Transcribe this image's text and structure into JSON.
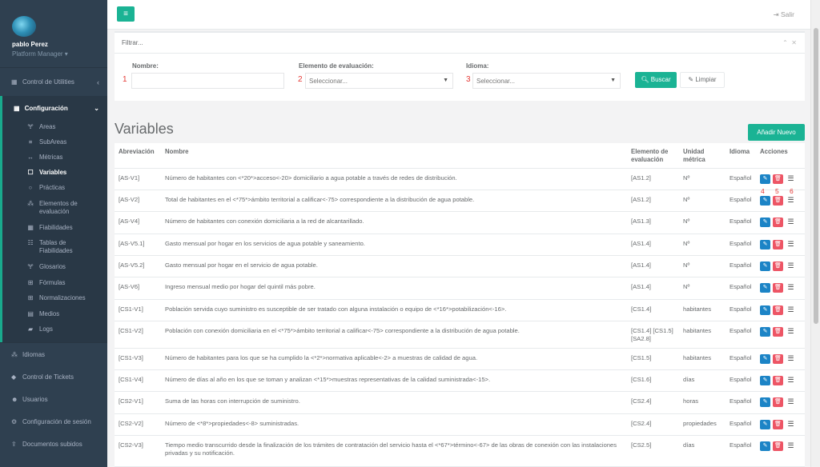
{
  "sidebar": {
    "user_name": "pablo Perez",
    "user_role": "Platform Manager ▾",
    "control_utilities": "Control de Utilities",
    "configuracion": "Configuración",
    "sub_items": [
      {
        "icon": "🝖",
        "label": "Areas"
      },
      {
        "icon": "≡",
        "label": "SubAreas"
      },
      {
        "icon": "↔",
        "label": "Métricas"
      },
      {
        "icon": "☐",
        "label": "Variables"
      },
      {
        "icon": "○",
        "label": "Prácticas"
      },
      {
        "icon": "⁂",
        "label": "Elementos de evaluación"
      },
      {
        "icon": "▦",
        "label": "Fiabilidades"
      },
      {
        "icon": "☷",
        "label": "Tablas de Fiabilidades"
      },
      {
        "icon": "🝖",
        "label": "Glosarios"
      },
      {
        "icon": "⊞",
        "label": "Fórmulas"
      },
      {
        "icon": "⊞",
        "label": "Normalizaciones"
      },
      {
        "icon": "▤",
        "label": "Medios"
      },
      {
        "icon": "▰",
        "label": "Logs"
      }
    ],
    "after_items": [
      {
        "icon": "⁂",
        "label": "Idiomas"
      },
      {
        "icon": "◆",
        "label": "Control de Tickets"
      },
      {
        "icon": "☻",
        "label": "Usuarios"
      },
      {
        "icon": "⚙",
        "label": "Configuración de sesión"
      },
      {
        "icon": "⇪",
        "label": "Documentos subidos"
      }
    ]
  },
  "topbar": {
    "menu": "≡",
    "logout": "Salir"
  },
  "filter": {
    "title": "Filtrar...",
    "nombre_label": "Nombre:",
    "elemento_label": "Elemento de evaluación:",
    "idioma_label": "Idioma:",
    "elemento_placeholder": "Seleccionar...",
    "idioma_placeholder": "Seleccionar...",
    "buscar": "Buscar",
    "limpiar": "Limpiar",
    "num1": "1",
    "num2": "2",
    "num3": "3"
  },
  "page": {
    "title": "Variables",
    "add_button": "Añadir Nuevo"
  },
  "table": {
    "headers": {
      "abrev": "Abreviación",
      "nombre": "Nombre",
      "elemento": "Elemento de evaluación",
      "unidad": "Unidad métrica",
      "idioma": "Idioma",
      "acciones": "Acciones"
    },
    "rows": [
      {
        "abrev": "[AS-V1]",
        "nombre": "Número de habitantes con <*20*>acceso<-20> domiciliario a agua potable a través de redes de distribución.",
        "elemento": "[AS1.2]",
        "unidad": "Nº",
        "idioma": "Español"
      },
      {
        "abrev": "[AS-V2]",
        "nombre": "Total de habitantes en el <*75*>ámbito territorial a calificar<-75> correspondiente a la distribución de agua potable.",
        "elemento": "[AS1.2]",
        "unidad": "Nº",
        "idioma": "Español"
      },
      {
        "abrev": "[AS-V4]",
        "nombre": "Número de habitantes con conexión domiciliaria a la red de alcantarillado.",
        "elemento": "[AS1.3]",
        "unidad": "Nº",
        "idioma": "Español"
      },
      {
        "abrev": "[AS-V5.1]",
        "nombre": "Gasto mensual por hogar en los servicios de agua potable y saneamiento.",
        "elemento": "[AS1.4]",
        "unidad": "Nº",
        "idioma": "Español"
      },
      {
        "abrev": "[AS-V5.2]",
        "nombre": "Gasto mensual por hogar en el servicio de agua potable.",
        "elemento": "[AS1.4]",
        "unidad": "Nº",
        "idioma": "Español"
      },
      {
        "abrev": "[AS-V6]",
        "nombre": "Ingreso mensual medio por hogar del quintil más pobre.",
        "elemento": "[AS1.4]",
        "unidad": "Nº",
        "idioma": "Español"
      },
      {
        "abrev": "[CS1-V1]",
        "nombre": "Población servida cuyo suministro es susceptible de ser tratado con alguna instalación o equipo de <*16*>potabilización<-16>.",
        "elemento": "[CS1.4]",
        "unidad": "habitantes",
        "idioma": "Español"
      },
      {
        "abrev": "[CS1-V2]",
        "nombre": "Población con conexión domiciliaria en el <*75*>ámbito territorial a calificar<-75> correspondiente a la distribución de agua potable.",
        "elemento": "[CS1.4] [CS1.5] [SA2.8]",
        "unidad": "habitantes",
        "idioma": "Español"
      },
      {
        "abrev": "[CS1-V3]",
        "nombre": "Número de habitantes para los que se ha cumplido la <*2*>normativa aplicable<-2> a muestras de calidad de agua.",
        "elemento": "[CS1.5]",
        "unidad": "habitantes",
        "idioma": "Español"
      },
      {
        "abrev": "[CS1-V4]",
        "nombre": "Número de días al año en los que se toman y analizan <*15*>muestras representativas de la calidad suministrada<-15>.",
        "elemento": "[CS1.6]",
        "unidad": "días",
        "idioma": "Español"
      },
      {
        "abrev": "[CS2-V1]",
        "nombre": "Suma de las horas con interrupción de suministro.",
        "elemento": "[CS2.4]",
        "unidad": "horas",
        "idioma": "Español"
      },
      {
        "abrev": "[CS2-V2]",
        "nombre": "Número de <*8*>propiedades<-8> suministradas.",
        "elemento": "[CS2.4]",
        "unidad": "propiedades",
        "idioma": "Español"
      },
      {
        "abrev": "[CS2-V3]",
        "nombre": "Tiempo medio transcurrido desde la finalización de los trámites de contratación del servicio hasta el <*67*>término<-67> de las obras de conexión con las instalaciones privadas y su notificación.",
        "elemento": "[CS2.5]",
        "unidad": "días",
        "idioma": "Español"
      }
    ],
    "action_numbers": [
      "4",
      "5",
      "6"
    ]
  },
  "colors": {
    "sidebar": "#2f4050",
    "accent": "#1ab394",
    "edit": "#1c84c6",
    "delete": "#ed5565"
  }
}
